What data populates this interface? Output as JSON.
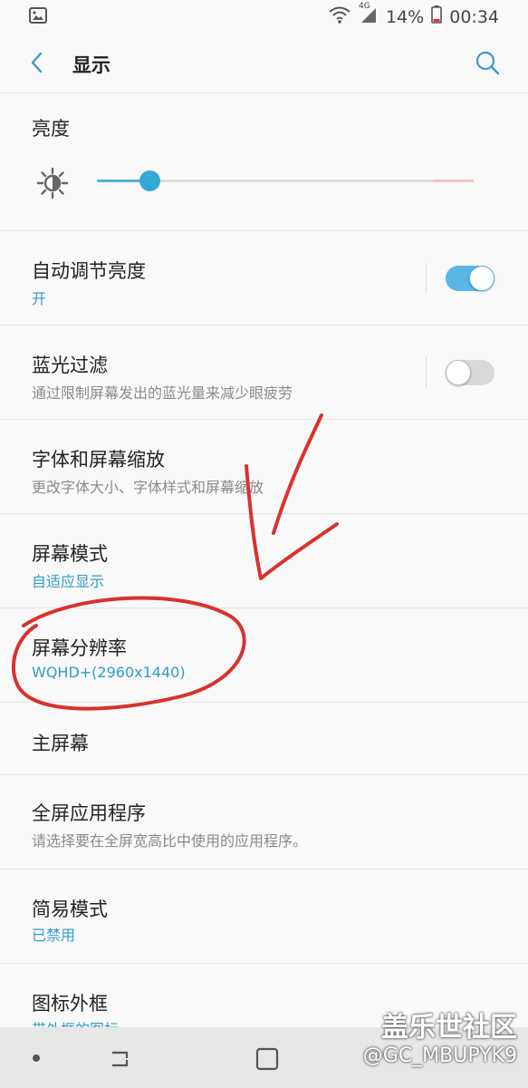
{
  "status_bar": {
    "battery": "14%",
    "time": "00:34",
    "network": "4G"
  },
  "header": {
    "title": "显示"
  },
  "brightness": {
    "label": "亮度",
    "level": 0.14
  },
  "rows": [
    {
      "title": "自动调节亮度",
      "subtitle": "开",
      "toggle": "on"
    },
    {
      "title": "蓝光过滤",
      "subtitle": "通过限制屏幕发出的蓝光量来减少眼疲劳",
      "toggle": "off"
    },
    {
      "title": "字体和屏幕缩放",
      "subtitle": "更改字体大小、字体样式和屏幕缩放"
    },
    {
      "title": "屏幕模式",
      "subtitle": "自适应显示"
    },
    {
      "title": "屏幕分辨率",
      "subtitle": "WQHD+(2960x1440)"
    },
    {
      "title": "主屏幕"
    },
    {
      "title": "全屏应用程序",
      "subtitle": "请选择要在全屏宽高比中使用的应用程序。"
    },
    {
      "title": "简易模式",
      "subtitle": "已禁用"
    },
    {
      "title": "图标外框",
      "subtitle": "带外框的图标"
    }
  ],
  "watermark": {
    "line1": "盖乐世社区",
    "line2": "@GC_MBUPYK9"
  },
  "colors": {
    "accent": "#2f9cc8",
    "annotation": "#d9322c"
  }
}
